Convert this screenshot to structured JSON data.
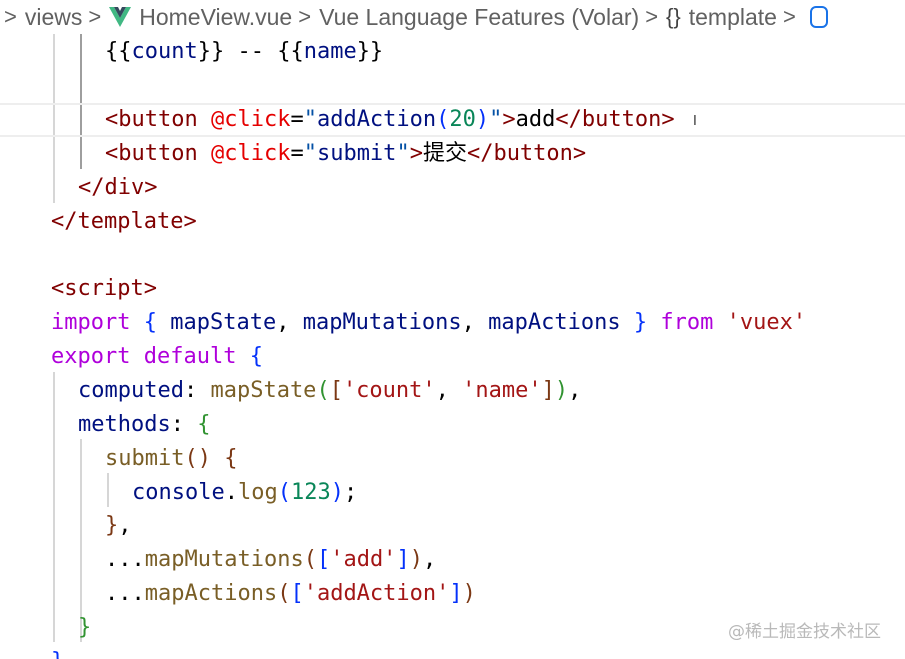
{
  "breadcrumb": {
    "items": [
      "views",
      "HomeView.vue",
      "Vue Language Features (Volar)",
      "template"
    ],
    "separator": ">",
    "vue_icon_colors": {
      "outer": "#41b883",
      "inner": "#35495e"
    },
    "braces": "{}"
  },
  "editor": {
    "lines": [
      {
        "id": "l1",
        "segments": [
          [
            "txt",
            "{{"
          ],
          [
            "var",
            "count"
          ],
          [
            "txt",
            "}} -- {{"
          ],
          [
            "var",
            "name"
          ],
          [
            "txt",
            "}}"
          ]
        ]
      },
      {
        "id": "l2",
        "segments": []
      },
      {
        "id": "l3",
        "segments": [
          [
            "tag",
            "<button"
          ],
          [
            "txt",
            " "
          ],
          [
            "attr",
            "@"
          ],
          [
            "attr",
            "click"
          ],
          [
            "txt",
            "="
          ],
          [
            "str",
            "\""
          ],
          [
            "var",
            "addAction"
          ],
          [
            "b1",
            "("
          ],
          [
            "num",
            "20"
          ],
          [
            "b1",
            ")"
          ],
          [
            "str",
            "\""
          ],
          [
            "tag",
            ">"
          ],
          [
            "txt",
            "add"
          ],
          [
            "tag",
            "</button>"
          ]
        ]
      },
      {
        "id": "l4",
        "segments": [
          [
            "tag",
            "<button"
          ],
          [
            "txt",
            " "
          ],
          [
            "attr",
            "@"
          ],
          [
            "attr",
            "click"
          ],
          [
            "txt",
            "="
          ],
          [
            "str",
            "\""
          ],
          [
            "var",
            "submit"
          ],
          [
            "str",
            "\""
          ],
          [
            "tag",
            ">"
          ],
          [
            "txt",
            "提交"
          ],
          [
            "tag",
            "</button>"
          ]
        ]
      },
      {
        "id": "l5",
        "segments": [
          [
            "tag",
            "</div>"
          ]
        ]
      },
      {
        "id": "l6",
        "segments": [
          [
            "tag",
            "</template>"
          ]
        ]
      },
      {
        "id": "l7",
        "segments": []
      },
      {
        "id": "l8",
        "segments": [
          [
            "tag",
            "<script>"
          ]
        ]
      },
      {
        "id": "l9",
        "segments": [
          [
            "kw",
            "import"
          ],
          [
            "txt",
            " "
          ],
          [
            "b1",
            "{"
          ],
          [
            "txt",
            " "
          ],
          [
            "var",
            "mapState"
          ],
          [
            "txt",
            ", "
          ],
          [
            "var",
            "mapMutations"
          ],
          [
            "txt",
            ", "
          ],
          [
            "var",
            "mapActions"
          ],
          [
            "txt",
            " "
          ],
          [
            "b1",
            "}"
          ],
          [
            "txt",
            " "
          ],
          [
            "kw",
            "from"
          ],
          [
            "txt",
            " "
          ],
          [
            "val",
            "'vuex'"
          ]
        ]
      },
      {
        "id": "l10",
        "segments": [
          [
            "kw",
            "export"
          ],
          [
            "txt",
            " "
          ],
          [
            "kw",
            "default"
          ],
          [
            "txt",
            " "
          ],
          [
            "b1",
            "{"
          ]
        ]
      },
      {
        "id": "l11",
        "segments": [
          [
            "var",
            "computed"
          ],
          [
            "txt",
            ": "
          ],
          [
            "fn",
            "mapState"
          ],
          [
            "b2",
            "("
          ],
          [
            "b3",
            "["
          ],
          [
            "val",
            "'count'"
          ],
          [
            "txt",
            ", "
          ],
          [
            "val",
            "'name'"
          ],
          [
            "b3",
            "]"
          ],
          [
            "b2",
            ")"
          ],
          [
            "txt",
            ","
          ]
        ]
      },
      {
        "id": "l12",
        "segments": [
          [
            "var",
            "methods"
          ],
          [
            "txt",
            ": "
          ],
          [
            "b2",
            "{"
          ]
        ]
      },
      {
        "id": "l13",
        "segments": [
          [
            "fn",
            "submit"
          ],
          [
            "b3",
            "()"
          ],
          [
            "txt",
            " "
          ],
          [
            "b3",
            "{"
          ]
        ]
      },
      {
        "id": "l14",
        "segments": [
          [
            "var",
            "console"
          ],
          [
            "txt",
            "."
          ],
          [
            "fn",
            "log"
          ],
          [
            "b1",
            "("
          ],
          [
            "num",
            "123"
          ],
          [
            "b1",
            ")"
          ],
          [
            "txt",
            ";"
          ]
        ]
      },
      {
        "id": "l15",
        "segments": [
          [
            "b3",
            "}"
          ],
          [
            "txt",
            ","
          ]
        ]
      },
      {
        "id": "l16",
        "segments": [
          [
            "txt",
            "..."
          ],
          [
            "fn",
            "mapMutations"
          ],
          [
            "b3",
            "("
          ],
          [
            "b1",
            "["
          ],
          [
            "val",
            "'add'"
          ],
          [
            "b1",
            "]"
          ],
          [
            "b3",
            ")"
          ],
          [
            "txt",
            ","
          ]
        ]
      },
      {
        "id": "l17",
        "segments": [
          [
            "txt",
            "..."
          ],
          [
            "fn",
            "mapActions"
          ],
          [
            "b3",
            "("
          ],
          [
            "b1",
            "["
          ],
          [
            "val",
            "'addAction'"
          ],
          [
            "b1",
            "]"
          ],
          [
            "b3",
            ")"
          ]
        ]
      },
      {
        "id": "l18",
        "segments": [
          [
            "b2",
            "}"
          ]
        ]
      },
      {
        "id": "l19",
        "segments": [
          [
            "b1",
            "}"
          ]
        ]
      }
    ]
  },
  "watermark": "@稀土掘金技术社区",
  "colors": {
    "tag": "#800000",
    "attribute": "#e50000",
    "keyword": "#af00db",
    "function": "#795e26",
    "string": "#a31515",
    "number": "#098658",
    "variable": "#001080"
  }
}
